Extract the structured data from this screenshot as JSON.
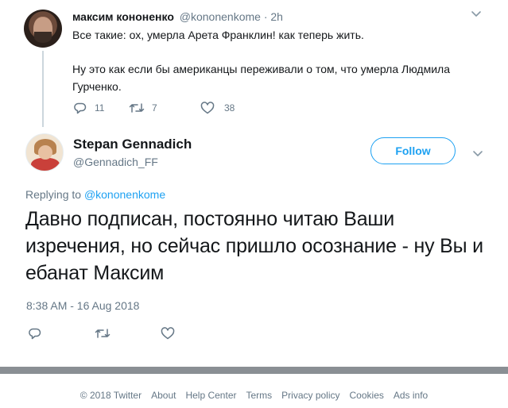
{
  "parent_tweet": {
    "display_name": "максим кононенко",
    "handle": "@kononenkome",
    "separator": "·",
    "time": "2h",
    "text_line1": "Все такие: ох, умерла Арета Франклин! как теперь жить.",
    "text_line2": "Ну это как если бы американцы переживали о том, что умерла Людмила Гурченко.",
    "reply_count": "11",
    "retweet_count": "7",
    "like_count": "38"
  },
  "main_tweet": {
    "display_name": "Stepan Gennadich",
    "handle": "@Gennadich_FF",
    "follow_label": "Follow",
    "replying_prefix": "Replying to",
    "replying_handle": "@kononenkome",
    "text": "Давно подписан, постоянно читаю Ваши изречения, но сейчас пришло осознание - ну Вы и ебанат Максим",
    "timestamp": "8:38 AM - 16 Aug 2018"
  },
  "footer": {
    "links": [
      "© 2018 Twitter",
      "About",
      "Help Center",
      "Terms",
      "Privacy policy",
      "Cookies",
      "Ads info"
    ]
  },
  "colors": {
    "accent": "#1da1f2",
    "secondary_text": "#657786",
    "primary_text": "#14171a"
  },
  "icons": {
    "reply": "reply-icon",
    "retweet": "retweet-icon",
    "like": "heart-icon",
    "more": "chevron-down-icon"
  }
}
